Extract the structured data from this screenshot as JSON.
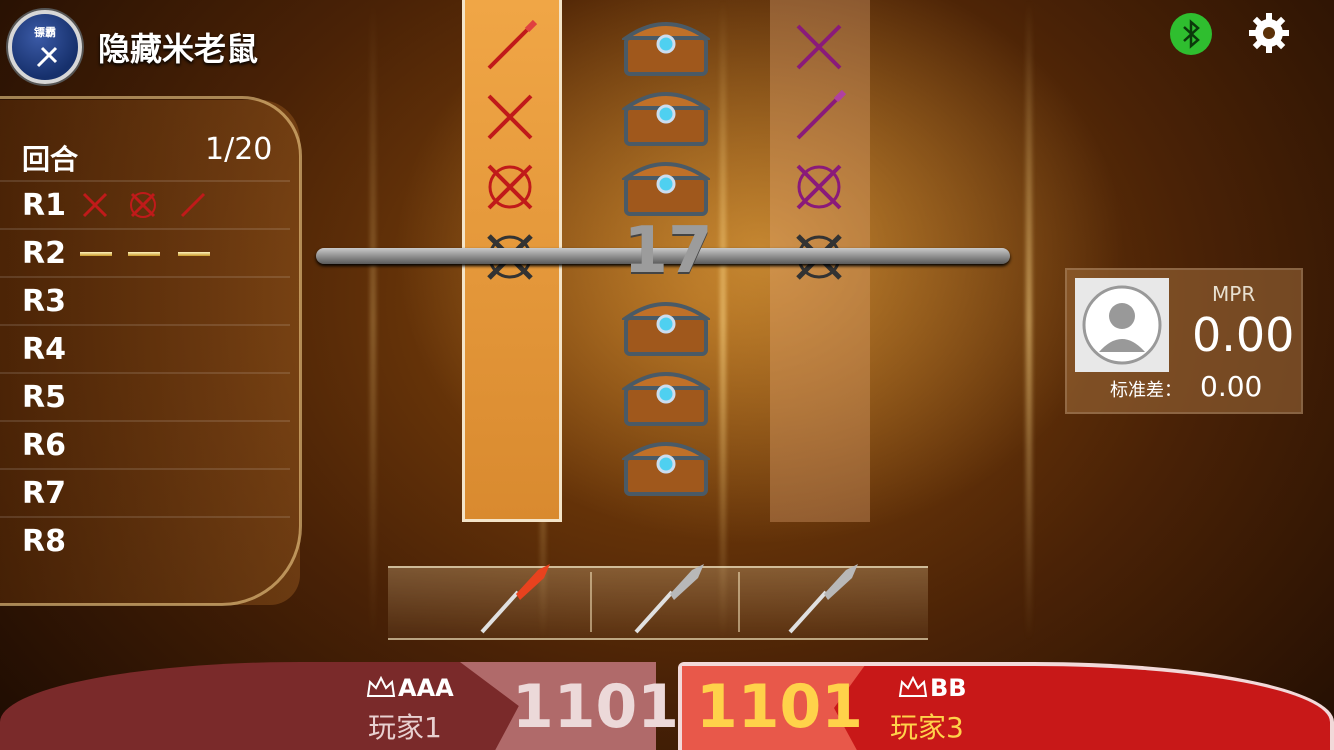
{
  "header": {
    "title": "隐藏米老鼠",
    "logo_text": "镖霸"
  },
  "scoreboard": {
    "round_label": "回合",
    "round_value": "1/20",
    "rows": [
      "R1",
      "R2",
      "R3",
      "R4",
      "R5",
      "R6",
      "R7",
      "R8"
    ]
  },
  "board": {
    "center_number": "17"
  },
  "stats": {
    "mpr_label": "MPR",
    "mpr_value": "0.00",
    "sd_label": "标准差：",
    "sd_value": "0.00"
  },
  "players": [
    {
      "name": "AAA",
      "label": "玩家1",
      "score": "1101",
      "active": false
    },
    {
      "name": "BB",
      "label": "玩家3",
      "score": "1101",
      "active": true
    }
  ],
  "colors": {
    "active_dart": "#e8421e",
    "inactive_dart": "#b8b8b8",
    "bluetooth": "#2fbe2f",
    "p1_panel": "#7a2a2a",
    "p3_panel": "#c81818"
  }
}
